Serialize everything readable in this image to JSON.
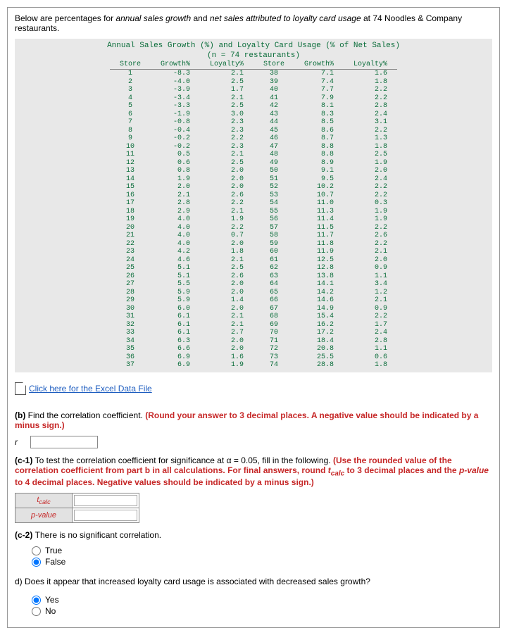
{
  "intro_prefix": "Below are percentages for ",
  "intro_em1": "annual sales growth",
  "intro_mid": " and ",
  "intro_em2": "net sales attributed to loyalty card usage",
  "intro_suffix": " at 74 Noodles & Company restaurants.",
  "table_title": "Annual Sales Growth (%) and Loyalty Card Usage (% of Net Sales)",
  "table_sub": "(n = 74 restaurants)",
  "th_store": "Store",
  "th_growth": "Growth%",
  "th_loyalty": "Loyalty%",
  "rows_left": [
    {
      "s": "1",
      "g": "-8.3",
      "l": "2.1"
    },
    {
      "s": "2",
      "g": "-4.0",
      "l": "2.5"
    },
    {
      "s": "3",
      "g": "-3.9",
      "l": "1.7"
    },
    {
      "s": "4",
      "g": "-3.4",
      "l": "2.1"
    },
    {
      "s": "5",
      "g": "-3.3",
      "l": "2.5"
    },
    {
      "s": "6",
      "g": "-1.9",
      "l": "3.0"
    },
    {
      "s": "7",
      "g": "-0.8",
      "l": "2.3"
    },
    {
      "s": "8",
      "g": "-0.4",
      "l": "2.3"
    },
    {
      "s": "9",
      "g": "-0.2",
      "l": "2.2"
    },
    {
      "s": "10",
      "g": "-0.2",
      "l": "2.3"
    },
    {
      "s": "11",
      "g": "0.5",
      "l": "2.1"
    },
    {
      "s": "12",
      "g": "0.6",
      "l": "2.5"
    },
    {
      "s": "13",
      "g": "0.8",
      "l": "2.0"
    },
    {
      "s": "14",
      "g": "1.9",
      "l": "2.0"
    },
    {
      "s": "15",
      "g": "2.0",
      "l": "2.0"
    },
    {
      "s": "16",
      "g": "2.1",
      "l": "2.6"
    },
    {
      "s": "17",
      "g": "2.8",
      "l": "2.2"
    },
    {
      "s": "18",
      "g": "2.9",
      "l": "2.1"
    },
    {
      "s": "19",
      "g": "4.0",
      "l": "1.9"
    },
    {
      "s": "20",
      "g": "4.0",
      "l": "2.2"
    },
    {
      "s": "21",
      "g": "4.0",
      "l": "0.7"
    },
    {
      "s": "22",
      "g": "4.0",
      "l": "2.0"
    },
    {
      "s": "23",
      "g": "4.2",
      "l": "1.8"
    },
    {
      "s": "24",
      "g": "4.6",
      "l": "2.1"
    },
    {
      "s": "25",
      "g": "5.1",
      "l": "2.5"
    },
    {
      "s": "26",
      "g": "5.1",
      "l": "2.6"
    },
    {
      "s": "27",
      "g": "5.5",
      "l": "2.0"
    },
    {
      "s": "28",
      "g": "5.9",
      "l": "2.0"
    },
    {
      "s": "29",
      "g": "5.9",
      "l": "1.4"
    },
    {
      "s": "30",
      "g": "6.0",
      "l": "2.0"
    },
    {
      "s": "31",
      "g": "6.1",
      "l": "2.1"
    },
    {
      "s": "32",
      "g": "6.1",
      "l": "2.1"
    },
    {
      "s": "33",
      "g": "6.1",
      "l": "2.7"
    },
    {
      "s": "34",
      "g": "6.3",
      "l": "2.0"
    },
    {
      "s": "35",
      "g": "6.6",
      "l": "2.0"
    },
    {
      "s": "36",
      "g": "6.9",
      "l": "1.6"
    },
    {
      "s": "37",
      "g": "6.9",
      "l": "1.9"
    }
  ],
  "rows_right": [
    {
      "s": "38",
      "g": "7.1",
      "l": "1.6"
    },
    {
      "s": "39",
      "g": "7.4",
      "l": "1.8"
    },
    {
      "s": "40",
      "g": "7.7",
      "l": "2.2"
    },
    {
      "s": "41",
      "g": "7.9",
      "l": "2.2"
    },
    {
      "s": "42",
      "g": "8.1",
      "l": "2.8"
    },
    {
      "s": "43",
      "g": "8.3",
      "l": "2.4"
    },
    {
      "s": "44",
      "g": "8.5",
      "l": "3.1"
    },
    {
      "s": "45",
      "g": "8.6",
      "l": "2.2"
    },
    {
      "s": "46",
      "g": "8.7",
      "l": "1.3"
    },
    {
      "s": "47",
      "g": "8.8",
      "l": "1.8"
    },
    {
      "s": "48",
      "g": "8.8",
      "l": "2.5"
    },
    {
      "s": "49",
      "g": "8.9",
      "l": "1.9"
    },
    {
      "s": "50",
      "g": "9.1",
      "l": "2.0"
    },
    {
      "s": "51",
      "g": "9.5",
      "l": "2.4"
    },
    {
      "s": "52",
      "g": "10.2",
      "l": "2.2"
    },
    {
      "s": "53",
      "g": "10.7",
      "l": "2.2"
    },
    {
      "s": "54",
      "g": "11.0",
      "l": "0.3"
    },
    {
      "s": "55",
      "g": "11.3",
      "l": "1.9"
    },
    {
      "s": "56",
      "g": "11.4",
      "l": "1.9"
    },
    {
      "s": "57",
      "g": "11.5",
      "l": "2.2"
    },
    {
      "s": "58",
      "g": "11.7",
      "l": "2.6"
    },
    {
      "s": "59",
      "g": "11.8",
      "l": "2.2"
    },
    {
      "s": "60",
      "g": "11.9",
      "l": "2.1"
    },
    {
      "s": "61",
      "g": "12.5",
      "l": "2.0"
    },
    {
      "s": "62",
      "g": "12.8",
      "l": "0.9"
    },
    {
      "s": "63",
      "g": "13.8",
      "l": "1.1"
    },
    {
      "s": "64",
      "g": "14.1",
      "l": "3.4"
    },
    {
      "s": "65",
      "g": "14.2",
      "l": "1.2"
    },
    {
      "s": "66",
      "g": "14.6",
      "l": "2.1"
    },
    {
      "s": "67",
      "g": "14.9",
      "l": "0.9"
    },
    {
      "s": "68",
      "g": "15.4",
      "l": "2.2"
    },
    {
      "s": "69",
      "g": "16.2",
      "l": "1.7"
    },
    {
      "s": "70",
      "g": "17.2",
      "l": "2.4"
    },
    {
      "s": "71",
      "g": "18.4",
      "l": "2.8"
    },
    {
      "s": "72",
      "g": "20.8",
      "l": "1.1"
    },
    {
      "s": "73",
      "g": "25.5",
      "l": "0.6"
    },
    {
      "s": "74",
      "g": "28.8",
      "l": "1.8"
    }
  ],
  "excel_link": "Click here for the Excel Data File",
  "q_b_prefix": "(b) ",
  "q_b_text": "Find the correlation coefficient. ",
  "q_b_red": "(Round your answer to 3 decimal places. A negative value should be indicated by a minus sign.)",
  "r_label": "r",
  "q_c1_prefix": "(c-1) ",
  "q_c1_text": "To test the correlation coefficient for significance at α = 0.05, fill in the following. ",
  "q_c1_red_a": "(Use the rounded value of the correlation coefficient from part b in all calculations. For final answers, round ",
  "q_c1_red_tcalc": "t",
  "q_c1_red_tcalc_sub": "calc",
  "q_c1_red_b": " to 3 decimal places and the ",
  "q_c1_red_pval_em": "p-value",
  "q_c1_red_c": " to 4 decimal places. Negative values should be indicated by a minus sign.)",
  "tcalc_label_t": "t",
  "tcalc_label_sub": "calc",
  "pvalue_label": "p-value",
  "q_c2_prefix": "(c-2) ",
  "q_c2_text": "There is no significant correlation.",
  "opt_true": "True",
  "opt_false": "False",
  "q_d_prefix": "d) ",
  "q_d_text": "Does it appear that increased loyalty card usage is associated with decreased sales growth?",
  "opt_yes": "Yes",
  "opt_no": "No"
}
